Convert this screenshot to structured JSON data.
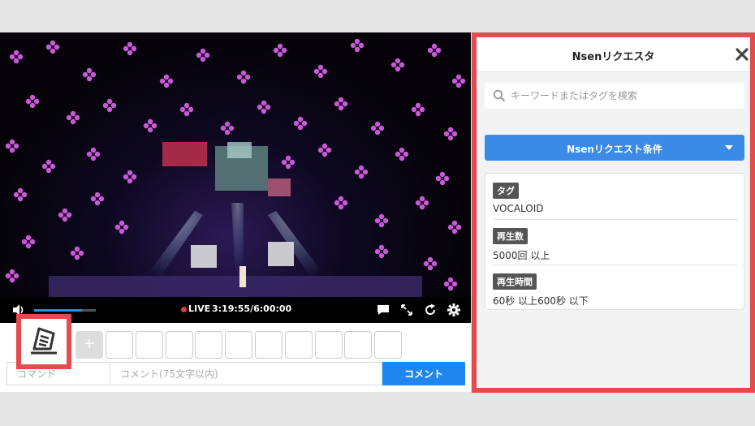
{
  "player": {
    "status": {
      "live_label": "LIVE",
      "elapsed": "3:19:55",
      "total": "6:00:00",
      "separator": "/"
    },
    "volume_fraction": 0.78,
    "stock_plus_label": "+",
    "stock_slots": 10,
    "inputs": {
      "command_placeholder": "コマンド",
      "comment_placeholder": "コメント(75文字以内)",
      "comment_button": "コメント"
    },
    "colors": {
      "accent": "#1f86f0",
      "live": "#e53a3a"
    }
  },
  "panel": {
    "title": "Nsenリクエスタ",
    "search_placeholder": "キーワードまたはタグを検索",
    "conditions_button": "Nsenリクエスト条件",
    "conditions": [
      {
        "label": "タグ",
        "value": "VOCALOID"
      },
      {
        "label": "再生数",
        "value": "5000回 以上"
      },
      {
        "label": "再生時間",
        "value": "60秒 以上600秒 以下"
      }
    ],
    "colors": {
      "highlight_border": "#e34b4f",
      "button": "#3b8ae8"
    }
  }
}
